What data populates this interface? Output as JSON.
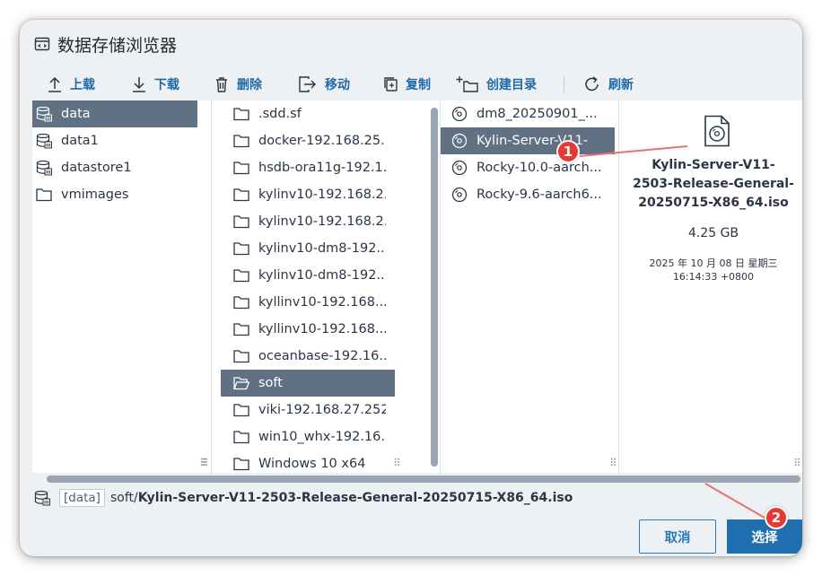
{
  "dialog": {
    "title": "数据存储浏览器"
  },
  "toolbar": {
    "upload": "上载",
    "download": "下载",
    "delete": "删除",
    "move": "移动",
    "copy": "复制",
    "mkdir": "创建目录",
    "refresh": "刷新"
  },
  "datastores": [
    {
      "label": "data",
      "icon": "datastore-icon",
      "selected": true
    },
    {
      "label": "data1",
      "icon": "datastore-icon"
    },
    {
      "label": "datastore1",
      "icon": "datastore-icon"
    },
    {
      "label": "vmimages",
      "icon": "folder-icon"
    }
  ],
  "folders": [
    {
      "label": ".sdd.sf"
    },
    {
      "label": "docker-192.168.25..."
    },
    {
      "label": "hsdb-ora11g-192.1..."
    },
    {
      "label": "kylinv10-192.168.2..."
    },
    {
      "label": "kylinv10-192.168.2..."
    },
    {
      "label": "kylinv10-dm8-192...."
    },
    {
      "label": "kylinv10-dm8-192...."
    },
    {
      "label": "kyllinv10-192.168...."
    },
    {
      "label": "kyllinv10-192.168...."
    },
    {
      "label": "oceanbase-192.16..."
    },
    {
      "label": "soft",
      "selected": true
    },
    {
      "label": "viki-192.168.27.252"
    },
    {
      "label": "win10_whx-192.16..."
    },
    {
      "label": "Windows 10 x64"
    }
  ],
  "files": [
    {
      "label": "dm8_20250901_..."
    },
    {
      "label": "Kylin-Server-V11-",
      "selected": true
    },
    {
      "label": "Rocky-10.0-aarch..."
    },
    {
      "label": "Rocky-9.6-aarch6..."
    }
  ],
  "preview": {
    "icon": "disc-image-file-icon",
    "name_line1": "Kylin-Server-V11-",
    "name_line2": "2503-Release-General-",
    "name_line3": "20250715-X86_64.iso",
    "size": "4.25 GB",
    "date_line1": "2025 年 10 月 08 日 星期三",
    "date_line2": "16:14:33 +0800"
  },
  "pathbar": {
    "datastore": "[data]",
    "dir": "soft/",
    "file": "Kylin-Server-V11-2503-Release-General-20250715-X86_64.iso"
  },
  "buttons": {
    "cancel": "取消",
    "select": "选择"
  },
  "annotations": {
    "step1": "1",
    "step2": "2",
    "color": "#e53935"
  },
  "colors": {
    "accent": "#1f6fb0",
    "selected_row": "#5f7182"
  }
}
